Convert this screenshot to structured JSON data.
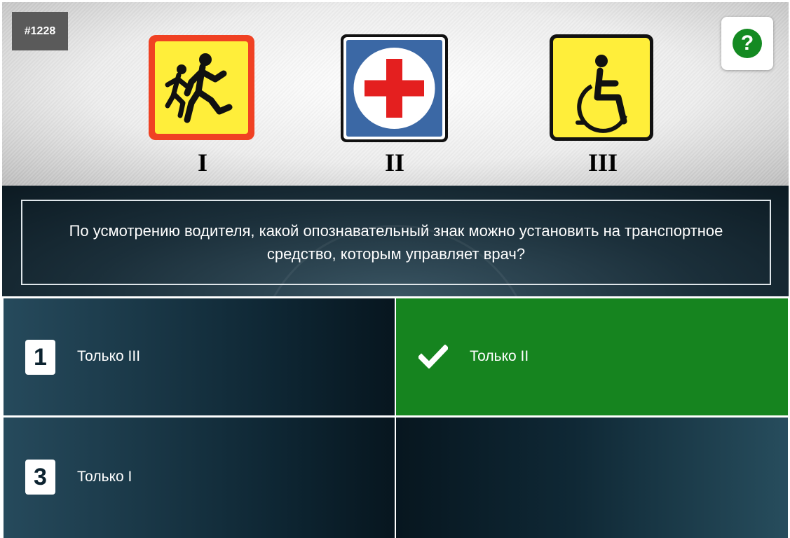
{
  "question_number": "#1228",
  "help_button": {
    "symbol": "?",
    "icon": "question-icon"
  },
  "signs": [
    {
      "label": "I",
      "icon": "children-sign-icon",
      "colors": {
        "border": "#f04123",
        "fill": "#ffee3a"
      }
    },
    {
      "label": "II",
      "icon": "doctor-sign-icon",
      "colors": {
        "border": "#111111",
        "fill": "#3b68a5",
        "cross": "#e41f1f"
      }
    },
    {
      "label": "III",
      "icon": "disabled-sign-icon",
      "colors": {
        "border": "#111111",
        "fill": "#ffee3a"
      }
    }
  ],
  "question": {
    "text": "По усмотрению водителя, какой опознавательный знак можно установить на транспортное средство, которым управляет врач?"
  },
  "answers": [
    {
      "number": "1",
      "text": "Только III",
      "state": "default"
    },
    {
      "number": "",
      "text": "Только II",
      "state": "correct",
      "icon": "checkmark-icon"
    },
    {
      "number": "3",
      "text": "Только I",
      "state": "default"
    },
    {
      "number": "",
      "text": "",
      "state": "empty"
    }
  ],
  "colors": {
    "correct": "#16841f",
    "help": "#148a22",
    "answer_dark": "#0e2633"
  }
}
